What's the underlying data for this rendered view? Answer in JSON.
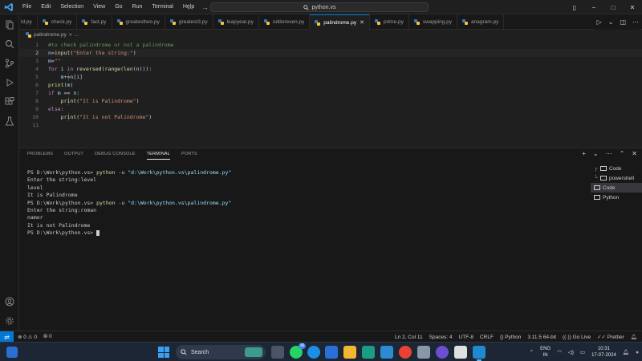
{
  "titlebar": {
    "menu": [
      "File",
      "Edit",
      "Selection",
      "View",
      "Go",
      "Run",
      "Terminal",
      "Help"
    ],
    "search_text": "python.vs"
  },
  "tabs": [
    {
      "label": "ld.py",
      "active": false
    },
    {
      "label": "check.py",
      "active": false
    },
    {
      "label": "fact.py",
      "active": false
    },
    {
      "label": "greatesttwo.py",
      "active": false
    },
    {
      "label": "greatest3.py",
      "active": false
    },
    {
      "label": "leapyear.py",
      "active": false
    },
    {
      "label": "oddoreven.py",
      "active": false
    },
    {
      "label": "palindrome.py",
      "active": true
    },
    {
      "label": "prime.py",
      "active": false
    },
    {
      "label": "swapping.py",
      "active": false
    },
    {
      "label": "anagram.py",
      "active": false
    }
  ],
  "breadcrumb": {
    "file": "palindrome.py",
    "sep": ">",
    "more": "..."
  },
  "editor": {
    "current_line": 2,
    "lines": [
      {
        "n": "1",
        "tokens": [
          {
            "t": "#to check palindrome or not a palindrome",
            "c": "c-comment"
          }
        ]
      },
      {
        "n": "2",
        "tokens": [
          {
            "t": "n",
            "c": "c-var"
          },
          {
            "t": "=",
            "c": ""
          },
          {
            "t": "input",
            "c": "c-fn"
          },
          {
            "t": "(",
            "c": ""
          },
          {
            "t": "\"Enter the string:\"",
            "c": "c-str"
          },
          {
            "t": ")",
            "c": ""
          }
        ]
      },
      {
        "n": "3",
        "tokens": [
          {
            "t": "m",
            "c": "c-var"
          },
          {
            "t": "=",
            "c": ""
          },
          {
            "t": "\"\"",
            "c": "c-str"
          }
        ]
      },
      {
        "n": "4",
        "tokens": [
          {
            "t": "for",
            "c": "c-kw"
          },
          {
            "t": " ",
            "c": ""
          },
          {
            "t": "i",
            "c": "c-var"
          },
          {
            "t": " ",
            "c": ""
          },
          {
            "t": "in",
            "c": "c-kw"
          },
          {
            "t": " ",
            "c": ""
          },
          {
            "t": "reversed",
            "c": "c-fn"
          },
          {
            "t": "(",
            "c": ""
          },
          {
            "t": "range",
            "c": "c-fn"
          },
          {
            "t": "(",
            "c": ""
          },
          {
            "t": "len",
            "c": "c-fn"
          },
          {
            "t": "(",
            "c": ""
          },
          {
            "t": "n",
            "c": "c-var"
          },
          {
            "t": "))):",
            "c": ""
          }
        ]
      },
      {
        "n": "5",
        "tokens": [
          {
            "t": "    ",
            "c": ""
          },
          {
            "t": "m",
            "c": "c-var"
          },
          {
            "t": "+=",
            "c": ""
          },
          {
            "t": "n",
            "c": "c-var"
          },
          {
            "t": "[",
            "c": ""
          },
          {
            "t": "i",
            "c": "c-var"
          },
          {
            "t": "]",
            "c": ""
          }
        ]
      },
      {
        "n": "6",
        "tokens": [
          {
            "t": "print",
            "c": "c-fn"
          },
          {
            "t": "(",
            "c": ""
          },
          {
            "t": "m",
            "c": "c-var"
          },
          {
            "t": ")",
            "c": ""
          }
        ]
      },
      {
        "n": "7",
        "tokens": [
          {
            "t": "if",
            "c": "c-kw"
          },
          {
            "t": " ",
            "c": ""
          },
          {
            "t": "m",
            "c": "c-var"
          },
          {
            "t": " == ",
            "c": ""
          },
          {
            "t": "n",
            "c": "c-var"
          },
          {
            "t": ":",
            "c": ""
          }
        ]
      },
      {
        "n": "8",
        "tokens": [
          {
            "t": "    ",
            "c": ""
          },
          {
            "t": "print",
            "c": "c-fn"
          },
          {
            "t": "(",
            "c": ""
          },
          {
            "t": "\"It is Palindrome\"",
            "c": "c-str"
          },
          {
            "t": ")",
            "c": ""
          }
        ]
      },
      {
        "n": "9",
        "tokens": [
          {
            "t": "else",
            "c": "c-kw"
          },
          {
            "t": ":",
            "c": ""
          }
        ]
      },
      {
        "n": "10",
        "tokens": [
          {
            "t": "    ",
            "c": ""
          },
          {
            "t": "print",
            "c": "c-fn"
          },
          {
            "t": "(",
            "c": ""
          },
          {
            "t": "\"It is not Palindrome\"",
            "c": "c-str"
          },
          {
            "t": ")",
            "c": ""
          }
        ]
      },
      {
        "n": "11",
        "tokens": []
      }
    ]
  },
  "panel": {
    "tabs": [
      "PROBLEMS",
      "OUTPUT",
      "DEBUG CONSOLE",
      "TERMINAL",
      "PORTS"
    ],
    "active_tab": "TERMINAL",
    "terminal_lines": [
      {
        "prompt": "PS D:\\Work\\python.vs> ",
        "cmd": "python",
        "args": " -u ",
        "path": "\"d:\\Work\\python.vs\\palindrome.py\""
      },
      {
        "text": "Enter the string:level"
      },
      {
        "text": "level"
      },
      {
        "text": "It is Palindrome"
      },
      {
        "prompt": "PS D:\\Work\\python.vs> ",
        "cmd": "python",
        "args": " -u ",
        "path": "\"d:\\Work\\python.vs\\palindrome.py\""
      },
      {
        "text": "Enter the string:roman"
      },
      {
        "text": "namor"
      },
      {
        "text": "It is not Palindrome"
      },
      {
        "prompt": "PS D:\\Work\\python.vs> ",
        "cursor": true
      }
    ],
    "terminal_list": [
      {
        "label": "Code",
        "tree": "┌",
        "active": false
      },
      {
        "label": "powershell",
        "tree": "└",
        "active": false
      },
      {
        "label": "Code",
        "tree": "",
        "active": true
      },
      {
        "label": "Python",
        "tree": "",
        "active": false
      }
    ]
  },
  "statusbar": {
    "errors": "0",
    "warnings": "0",
    "info": "0",
    "position": "Ln 2, Col 11",
    "spaces": "Spaces: 4",
    "encoding": "UTF-8",
    "eol": "CRLF",
    "language": "Python",
    "interpreter": "3.11.5 64-bit",
    "golive": "Go Live",
    "prettier": "Prettier"
  },
  "taskbar": {
    "search_label": "Search",
    "whatsapp_badge": "36",
    "lang_top": "ENG",
    "lang_bottom": "IN",
    "time": "10:31",
    "date": "17-07-2024"
  },
  "colors": {
    "accent": "#0078d4",
    "editor_bg": "#1f1f1f",
    "panel_bg": "#181818",
    "taskbar_bg": "#1c2634"
  }
}
